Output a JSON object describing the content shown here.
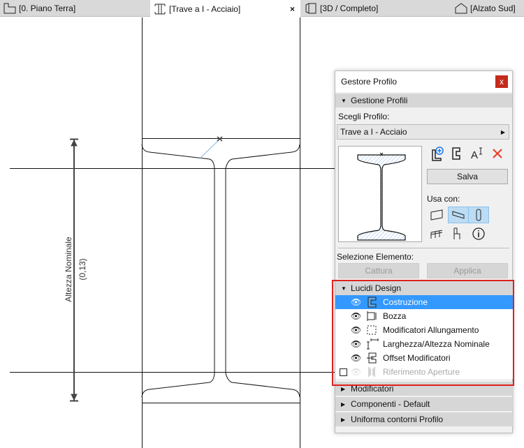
{
  "tabs": [
    {
      "label": "[0. Piano Terra]",
      "icon": "floor-plan-icon"
    },
    {
      "label": "[Trave a I - Acciaio]",
      "icon": "i-beam-icon",
      "active": true,
      "close": "×"
    },
    {
      "label": "[3D / Completo]",
      "icon": "3d-icon"
    },
    {
      "label": "[Alzato Sud]",
      "icon": "elevation-icon"
    }
  ],
  "drawing": {
    "dimension_label": "Altezza Nominale",
    "dimension_value": "(0,13)"
  },
  "panel": {
    "title": "Gestore Profilo",
    "close": "x",
    "section1": "Gestione Profili",
    "choose_label": "Scegli Profilo:",
    "profile": "Trave a I - Acciaio",
    "save": "Salva",
    "use_with": "Usa con:",
    "selection_label": "Selezione Elemento:",
    "capture": "Cattura",
    "apply": "Applica",
    "section2": "Lucidi Design",
    "layers": [
      {
        "label": "Costruzione",
        "selected": true
      },
      {
        "label": "Bozza"
      },
      {
        "label": "Modificatori Allungamento"
      },
      {
        "label": "Larghezza/Altezza Nominale"
      },
      {
        "label": "Offset Modificatori"
      },
      {
        "label": "Riferimento Aperture",
        "disabled": true
      }
    ],
    "collapsed_sections": [
      "Modificatori",
      "Componenti - Default",
      "Uniforma contorni Profilo"
    ]
  },
  "colors": {
    "selection": "#3399ff",
    "highlight": "#e0201c",
    "delete": "#e8412a"
  }
}
